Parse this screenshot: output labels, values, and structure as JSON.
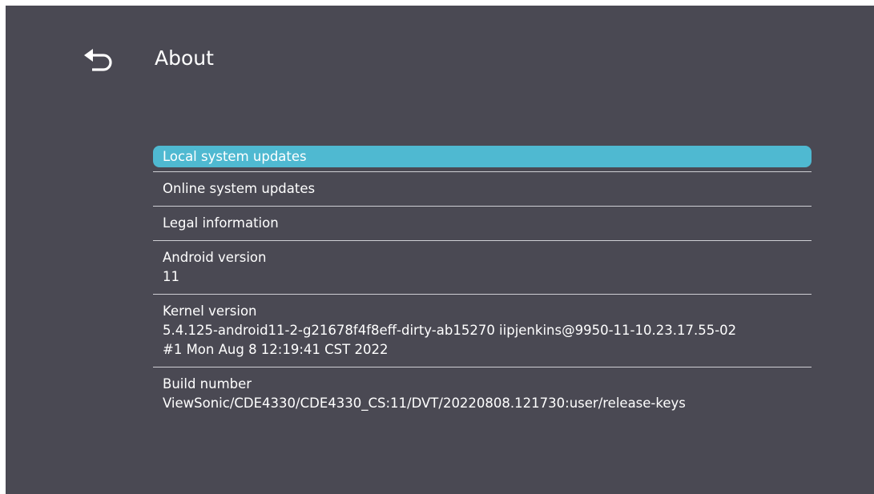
{
  "header": {
    "back_icon": "undo-arrow-icon",
    "title": "About"
  },
  "menu": {
    "items": [
      {
        "label": "Local system updates",
        "selected": true
      },
      {
        "label": "Online system updates"
      },
      {
        "label": "Legal information"
      },
      {
        "label": "Android version",
        "value": "11"
      },
      {
        "label": "Kernel version",
        "value": "5.4.125-android11-2-g21678f4f8eff-dirty-ab15270 iipjenkins@9950-11-10.23.17.55-02\n#1 Mon Aug 8 12:19:41 CST 2022"
      },
      {
        "label": "Build number",
        "value": "ViewSonic/CDE4330/CDE4330_CS:11/DVT/20220808.121730:user/release-keys"
      }
    ]
  },
  "colors": {
    "background": "#4a4953",
    "highlight": "#4fb9d1",
    "divider": "#cfcfd4",
    "text": "#ffffff"
  }
}
